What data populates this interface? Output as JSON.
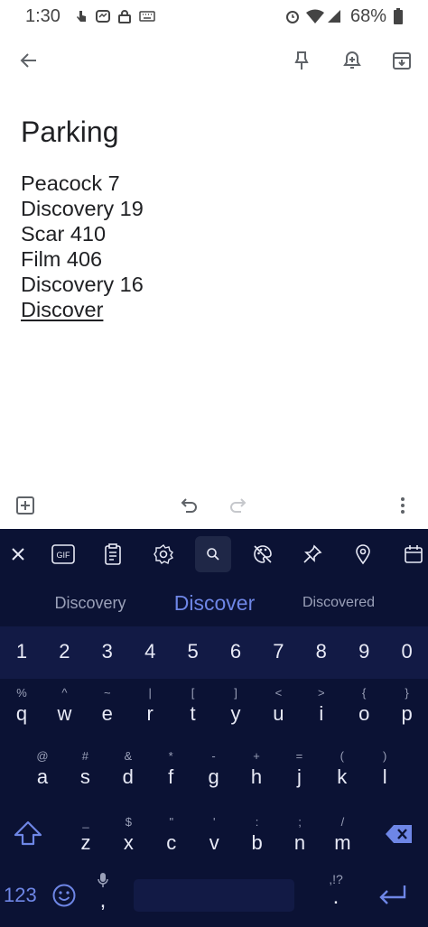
{
  "status_bar": {
    "time": "1:30",
    "battery": "68%",
    "icons": [
      "touch-icon",
      "messenger-icon",
      "lock-icon",
      "keyboard-icon",
      "alarm-icon",
      "wifi-icon",
      "signal-icon",
      "battery-icon"
    ]
  },
  "app_bar": {
    "icons": [
      "back-arrow-icon",
      "pin-icon",
      "reminder-bell-icon",
      "archive-icon"
    ]
  },
  "note": {
    "title": "Parking",
    "lines": [
      "Peacock 7",
      "Discovery 19",
      "Scar 410",
      "Film 406",
      "Discovery 16"
    ],
    "composing_word": "Discover"
  },
  "bottom_toolbar": {
    "icons": [
      "add-box-icon",
      "undo-icon",
      "redo-icon",
      "more-vert-icon"
    ]
  },
  "keyboard": {
    "colors": {
      "background": "#0b1234",
      "accent": "#6e86e6",
      "key_row": "#121a45"
    },
    "toolbar_icons": [
      "close-icon",
      "gif-icon",
      "clipboard-icon",
      "settings-icon",
      "search-icon",
      "palette-icon",
      "pin-icon",
      "location-icon",
      "calendar-icon"
    ],
    "gif_label": "GIF",
    "suggestions": [
      "Discovery",
      "Discover",
      "Discovered"
    ],
    "digits": [
      "1",
      "2",
      "3",
      "4",
      "5",
      "6",
      "7",
      "8",
      "9",
      "0"
    ],
    "row1": {
      "keys": [
        "q",
        "w",
        "e",
        "r",
        "t",
        "y",
        "u",
        "i",
        "o",
        "p"
      ],
      "hints": [
        "%",
        "^",
        "~",
        "|",
        "[",
        "]",
        "<",
        ">",
        "{",
        "}"
      ]
    },
    "row2": {
      "keys": [
        "a",
        "s",
        "d",
        "f",
        "g",
        "h",
        "j",
        "k",
        "l"
      ],
      "hints": [
        "@",
        "#",
        "&",
        "*",
        "-",
        "+",
        "=",
        "(",
        ")"
      ]
    },
    "row3": {
      "keys": [
        "z",
        "x",
        "c",
        "v",
        "b",
        "n",
        "m"
      ],
      "hints": [
        "_",
        "$",
        "\"",
        "'",
        ":",
        ";",
        "/"
      ]
    },
    "bottom_row": {
      "symbols_label": "123",
      "comma": ",",
      "period": ".",
      "period_hint": ",!?"
    }
  }
}
